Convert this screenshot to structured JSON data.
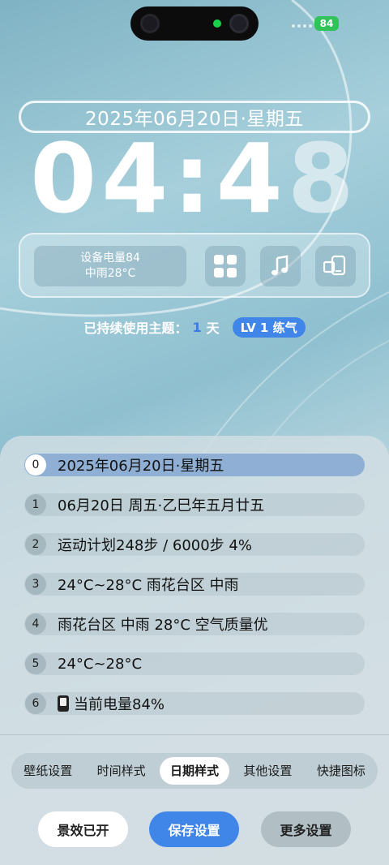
{
  "status_bar": {
    "battery_level": "84",
    "battery_icon": "battery-charging-icon",
    "signal_icon": "signal-dots-icon",
    "battery_color": "#2fc35a"
  },
  "lockscreen": {
    "date": "2025年06月20日·星期五",
    "time_hours": "04",
    "time_sep": ":",
    "time_min1": "4",
    "time_min2": "8",
    "widget": {
      "info_line1": "设备电量84",
      "info_line2": "中雨28°C",
      "buttons": [
        "apps-grid-icon",
        "music-note-icon",
        "screen-cast-icon"
      ]
    },
    "usage": {
      "prefix": "已持续使用主题：",
      "days": "1",
      "suffix": "天",
      "level": "LV 1  练气"
    }
  },
  "options": [
    {
      "num": "0",
      "text": "2025年06月20日·星期五",
      "selected": true
    },
    {
      "num": "1",
      "text": "06月20日 周五·乙巳年五月廿五",
      "selected": false
    },
    {
      "num": "2",
      "text": "运动计划248步 / 6000步 4%",
      "selected": false
    },
    {
      "num": "3",
      "text": "24°C~28°C 雨花台区 中雨",
      "selected": false
    },
    {
      "num": "4",
      "text": "雨花台区 中雨 28°C 空气质量优",
      "selected": false
    },
    {
      "num": "5",
      "text": "24°C~28°C",
      "selected": false
    },
    {
      "num": "6",
      "text": "当前电量84%",
      "selected": false,
      "icon": "phone-battery-icon"
    }
  ],
  "tabs": [
    "壁纸设置",
    "时间样式",
    "日期样式",
    "其他设置",
    "快捷图标"
  ],
  "active_tab": "日期样式",
  "actions": {
    "effects": "景效已开",
    "save": "保存设置",
    "more": "更多设置"
  },
  "colors": {
    "accent": "#3f86e8",
    "selected_row": "#8fb0d4"
  }
}
